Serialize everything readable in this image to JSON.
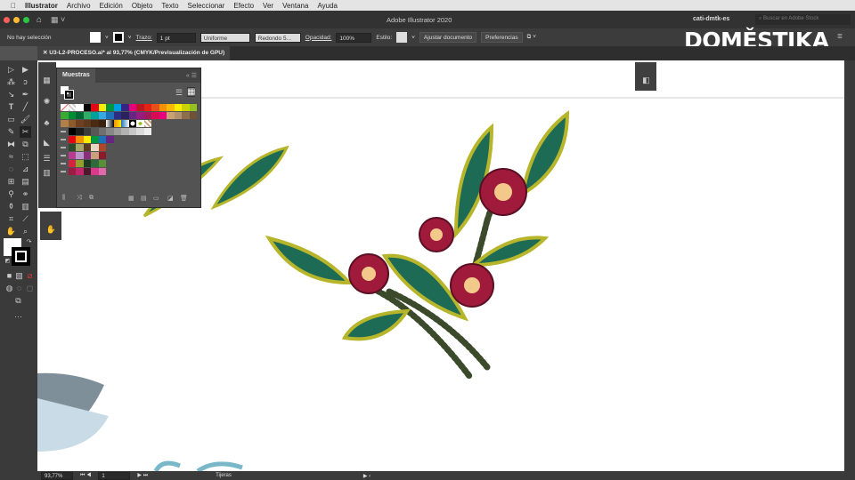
{
  "menubar": {
    "apple": "",
    "app": "Illustrator",
    "items": [
      "Archivo",
      "Edición",
      "Objeto",
      "Texto",
      "Seleccionar",
      "Efecto",
      "Ver",
      "Ventana",
      "Ayuda"
    ]
  },
  "appbar": {
    "title": "Adobe Illustrator 2020",
    "user": "cati-dmtk-es",
    "search_placeholder": "Buscar en Adobe Stock",
    "home_icon": "home-icon",
    "workspace_icon": "layout-icon"
  },
  "control": {
    "selection": "No hay selección",
    "stroke_label": "Trazo:",
    "stroke_value": "1 pt",
    "profile": "Uniforme",
    "brush": "Redondo 5...",
    "opacity_label": "Opacidad:",
    "opacity_value": "100%",
    "style_label": "Estilo:",
    "fit_button": "Ajustar documento",
    "prefs_button": "Preferencias"
  },
  "document": {
    "tab_title": "U3-L2-PROCESO.ai* al 93,77% (CMYK/Previsualización de GPU)"
  },
  "swatches_panel": {
    "title": "Muestras",
    "rows": [
      [
        "none",
        "reg",
        "#ffffff",
        "#000000",
        "#e30613",
        "#ffed00",
        "#009640",
        "#009fe3",
        "#312783",
        "#e6007e",
        "#be1622",
        "#e42313",
        "#e94e1b",
        "#f39200",
        "#fbba00",
        "#ffed00",
        "#cbd300",
        "#95c11f"
      ],
      [
        "#3aaa35",
        "#008d36",
        "#006633",
        "#2fac66",
        "#00a19a",
        "#36a9e1",
        "#1d71b8",
        "#2d2e83",
        "#29235c",
        "#662483",
        "#951b81",
        "#a3195b",
        "#d60b52",
        "#e6007e",
        "#c8a276",
        "#b0916f",
        "#8b6e4e",
        "#6f5136"
      ],
      [
        "#b17f4a",
        "#8d5b2c",
        "#6e4020",
        "#5c3a1b",
        "#4a2a12",
        "#3a2210",
        "grad1",
        "grad2",
        "grad3",
        "pat1",
        "pat2",
        "pat3"
      ],
      [
        "#000000",
        "#1d1d1b",
        "#3c3c3b",
        "#575756",
        "#706f6f",
        "#878787",
        "#9d9d9c",
        "#b2b2b2",
        "#c6c6c6",
        "#dadada",
        "#ededed"
      ],
      [
        "#e30613",
        "#f39200",
        "#ffed00",
        "#009640",
        "#1d71b8",
        "#662483"
      ],
      [
        "#2d4a2b",
        "#a4a66a",
        "#5a3a23",
        "#e6d9c3",
        "#b0452c"
      ],
      [
        "#b83b8f",
        "#b894c8",
        "#8a2f7c",
        "#c7a17e",
        "#8b1a2b"
      ],
      [
        "#d4223f",
        "#93a02b",
        "#1d3b24",
        "#2e6b3a",
        "#5a8f3a"
      ],
      [
        "#9b1b42",
        "#c2266d",
        "#4a1a2a",
        "#d93a8c",
        "#e06aa9"
      ]
    ],
    "footer_icons": [
      "library-icon",
      "swatch-options-icon",
      "place-icon",
      "color-group-icon",
      "edit-icon",
      "folder-icon",
      "new-swatch-icon",
      "trash-icon"
    ]
  },
  "logo": "DOMESTIKA",
  "status": {
    "zoom": "93,77%",
    "artboard": "1",
    "tool": "Tijeras"
  }
}
